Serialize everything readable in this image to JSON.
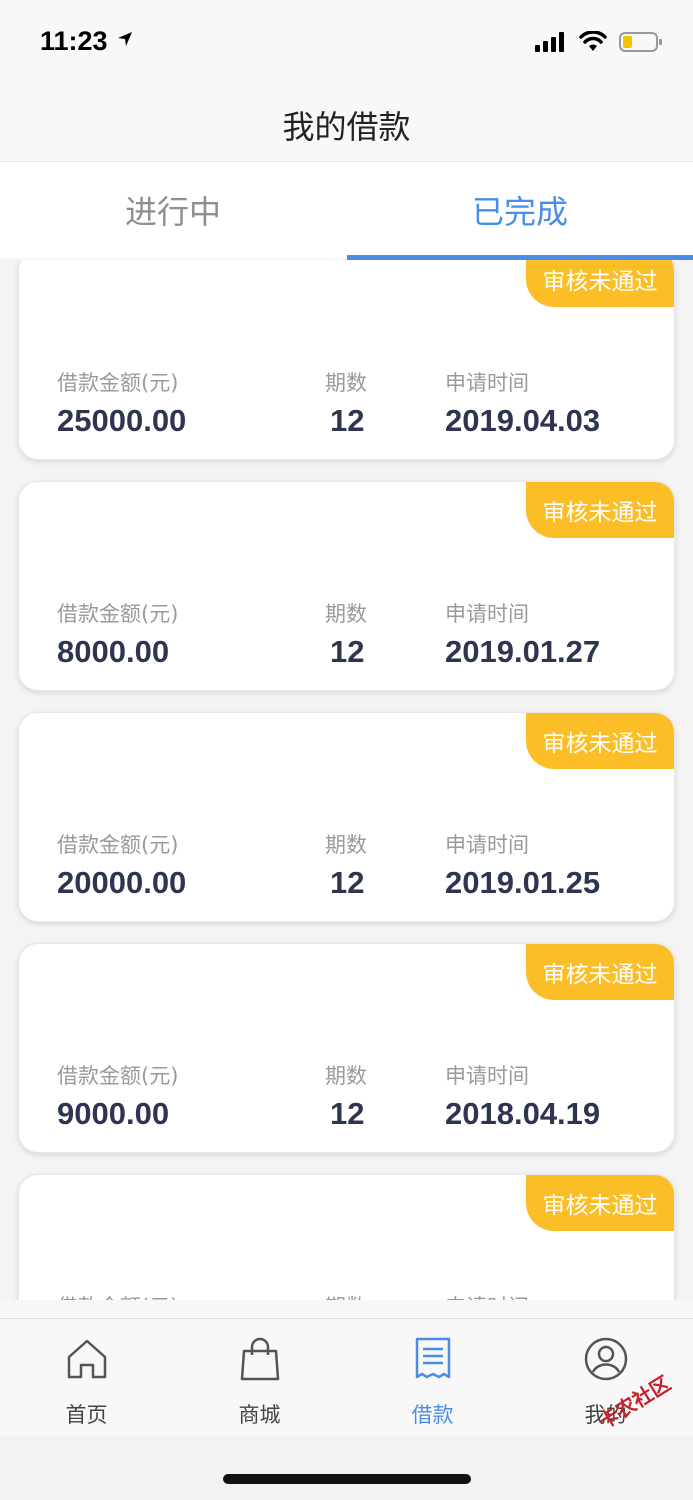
{
  "status_bar": {
    "time": "11:23"
  },
  "nav": {
    "title": "我的借款"
  },
  "tabs": [
    {
      "label": "进行中"
    },
    {
      "label": "已完成"
    }
  ],
  "loans": [
    {
      "badge": "审核未通过",
      "amount_label": "借款金额(元)",
      "amount": "25000.00",
      "periods_label": "期数",
      "periods": "12",
      "date_label": "申请时间",
      "date": "2019.04.03"
    },
    {
      "badge": "审核未通过",
      "amount_label": "借款金额(元)",
      "amount": "8000.00",
      "periods_label": "期数",
      "periods": "12",
      "date_label": "申请时间",
      "date": "2019.01.27"
    },
    {
      "badge": "审核未通过",
      "amount_label": "借款金额(元)",
      "amount": "20000.00",
      "periods_label": "期数",
      "periods": "12",
      "date_label": "申请时间",
      "date": "2019.01.25"
    },
    {
      "badge": "审核未通过",
      "amount_label": "借款金额(元)",
      "amount": "9000.00",
      "periods_label": "期数",
      "periods": "12",
      "date_label": "申请时间",
      "date": "2018.04.19"
    },
    {
      "badge": "审核未通过",
      "amount_label": "借款金额(元)",
      "periods_label": "期数",
      "date_label": "申请时间"
    }
  ],
  "tabbar": [
    {
      "label": "首页",
      "icon": "home-icon"
    },
    {
      "label": "商城",
      "icon": "shopping-bag-icon"
    },
    {
      "label": "借款",
      "icon": "receipt-icon"
    },
    {
      "label": "我的",
      "icon": "user-icon"
    }
  ],
  "watermark": {
    "text": "卡农社区"
  },
  "colors": {
    "accent": "#4a8de9",
    "badge": "#fbbe27",
    "value_text": "#2e3550"
  }
}
